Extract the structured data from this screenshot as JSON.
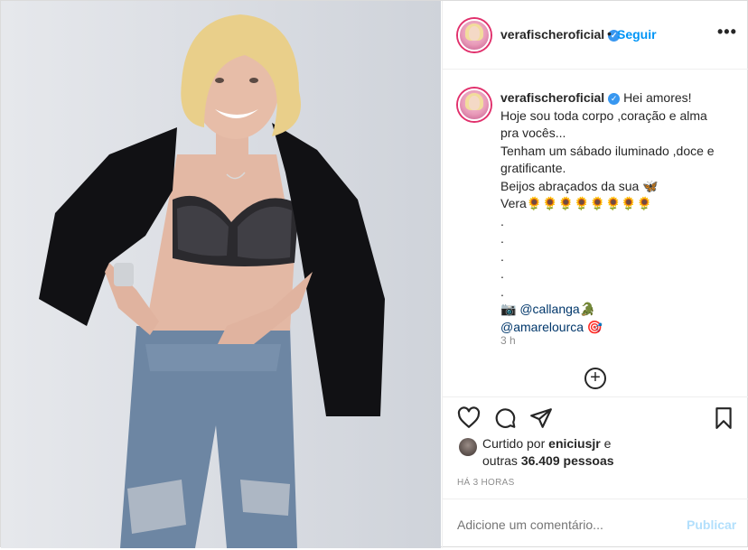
{
  "post": {
    "username": "verafischeroficial",
    "verified_icon": "verified-badge-icon",
    "follow_label": "Seguir",
    "more_label": "•••",
    "dot": "•"
  },
  "caption": {
    "username": "verafischeroficial",
    "lines": [
      "Hei amores!",
      "Hoje sou toda corpo ,coração e alma",
      "pra vocês...",
      "Tenham um sábado iluminado ,doce e",
      "gratificante.",
      "Beijos abraçados da sua 🦋",
      "Vera🌻🌻🌻🌻🌻🌻🌻🌻",
      ".",
      ".",
      ".",
      ".",
      "."
    ],
    "camera": "📷",
    "mention1": "@callanga",
    "mention1_emoji": "🐊",
    "mention2": "@amarelourca",
    "mention2_emoji": "🎯",
    "time": "3 h"
  },
  "load_more": "+",
  "likes": {
    "prefix": "Curtido por ",
    "user": "eniciusjr",
    "middle": " e",
    "line2_prefix": "outras ",
    "count": "36.409 pessoas"
  },
  "timestamp": "HÁ 3 HORAS",
  "comment": {
    "placeholder": "Adicione um comentário...",
    "publish_label": "Publicar"
  },
  "colors": {
    "accent": "#0095f6",
    "verified": "#3897f0",
    "publish_disabled": "#b2dffc",
    "muted": "#8e8e8e"
  }
}
